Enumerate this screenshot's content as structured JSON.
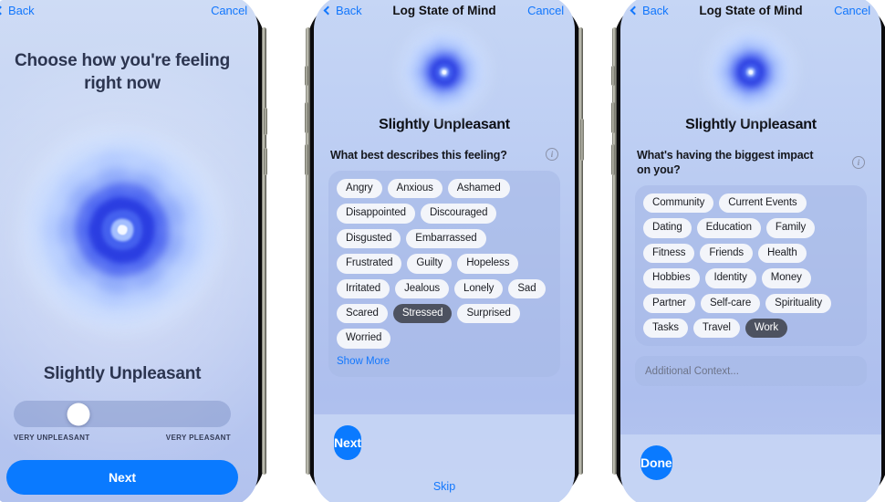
{
  "screens": [
    {
      "id": "mood-picker",
      "nav": {
        "back": "Back",
        "title": "",
        "cancel": "Cancel"
      },
      "headline": "Choose how you're feeling right now",
      "mood_label": "Slightly Unpleasant",
      "slider": {
        "value_percent": 30,
        "left_label": "VERY UNPLEASANT",
        "right_label": "VERY PLEASANT"
      },
      "primary_button": "Next"
    },
    {
      "id": "describe-feeling",
      "nav": {
        "back": "Back",
        "title": "Log State of Mind",
        "cancel": "Cancel"
      },
      "mood_label": "Slightly Unpleasant",
      "question": "What best describes this feeling?",
      "info_glyph": "i",
      "tags": [
        {
          "label": "Angry",
          "selected": false
        },
        {
          "label": "Anxious",
          "selected": false
        },
        {
          "label": "Ashamed",
          "selected": false
        },
        {
          "label": "Disappointed",
          "selected": false
        },
        {
          "label": "Discouraged",
          "selected": false
        },
        {
          "label": "Disgusted",
          "selected": false
        },
        {
          "label": "Embarrassed",
          "selected": false
        },
        {
          "label": "Frustrated",
          "selected": false
        },
        {
          "label": "Guilty",
          "selected": false
        },
        {
          "label": "Hopeless",
          "selected": false
        },
        {
          "label": "Irritated",
          "selected": false
        },
        {
          "label": "Jealous",
          "selected": false
        },
        {
          "label": "Lonely",
          "selected": false
        },
        {
          "label": "Sad",
          "selected": false
        },
        {
          "label": "Scared",
          "selected": false
        },
        {
          "label": "Stressed",
          "selected": true
        },
        {
          "label": "Surprised",
          "selected": false
        },
        {
          "label": "Worried",
          "selected": false
        }
      ],
      "show_more": "Show More",
      "primary_button": "Next",
      "secondary_button": "Skip"
    },
    {
      "id": "biggest-impact",
      "nav": {
        "back": "Back",
        "title": "Log State of Mind",
        "cancel": "Cancel"
      },
      "mood_label": "Slightly Unpleasant",
      "question": "What's having the biggest impact on you?",
      "info_glyph": "i",
      "tags": [
        {
          "label": "Community",
          "selected": false
        },
        {
          "label": "Current Events",
          "selected": false
        },
        {
          "label": "Dating",
          "selected": false
        },
        {
          "label": "Education",
          "selected": false
        },
        {
          "label": "Family",
          "selected": false
        },
        {
          "label": "Fitness",
          "selected": false
        },
        {
          "label": "Friends",
          "selected": false
        },
        {
          "label": "Health",
          "selected": false
        },
        {
          "label": "Hobbies",
          "selected": false
        },
        {
          "label": "Identity",
          "selected": false
        },
        {
          "label": "Money",
          "selected": false
        },
        {
          "label": "Partner",
          "selected": false
        },
        {
          "label": "Self-care",
          "selected": false
        },
        {
          "label": "Spirituality",
          "selected": false
        },
        {
          "label": "Tasks",
          "selected": false
        },
        {
          "label": "Travel",
          "selected": false
        },
        {
          "label": "Work",
          "selected": true
        }
      ],
      "context_placeholder": "Additional Context...",
      "primary_button": "Done"
    }
  ],
  "colors": {
    "accent_blue": "#0a7aff",
    "link_blue": "#1277fd",
    "selected_tag": "#4d5260",
    "tag_bg": "#f3f5fa",
    "screen_top": "#c6d6f5",
    "screen_bottom": "#aebfee"
  }
}
